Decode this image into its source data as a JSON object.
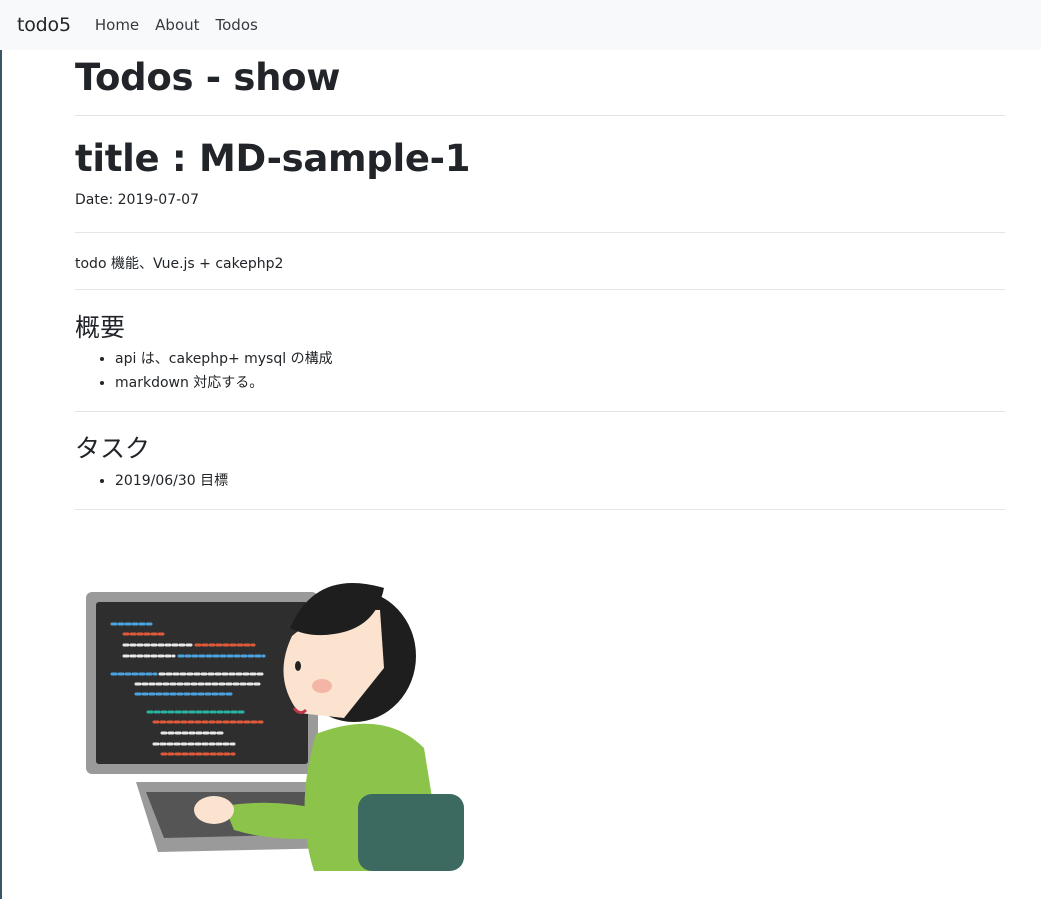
{
  "navbar": {
    "brand": "todo5",
    "links": [
      "Home",
      "About",
      "Todos"
    ]
  },
  "page": {
    "heading": "Todos - show"
  },
  "todo": {
    "title": "title : MD-sample-1",
    "date": "Date: 2019-07-07",
    "description": "todo 機能、Vue.js + cakephp2",
    "sections": [
      {
        "heading": "概要",
        "items": [
          "api は、cakephp+ mysql の構成",
          "markdown 対応する。"
        ]
      },
      {
        "heading": "タスク",
        "items": [
          "2019/06/30 目標"
        ]
      }
    ]
  },
  "image": {
    "icon": "programmer-at-laptop-illustration"
  }
}
